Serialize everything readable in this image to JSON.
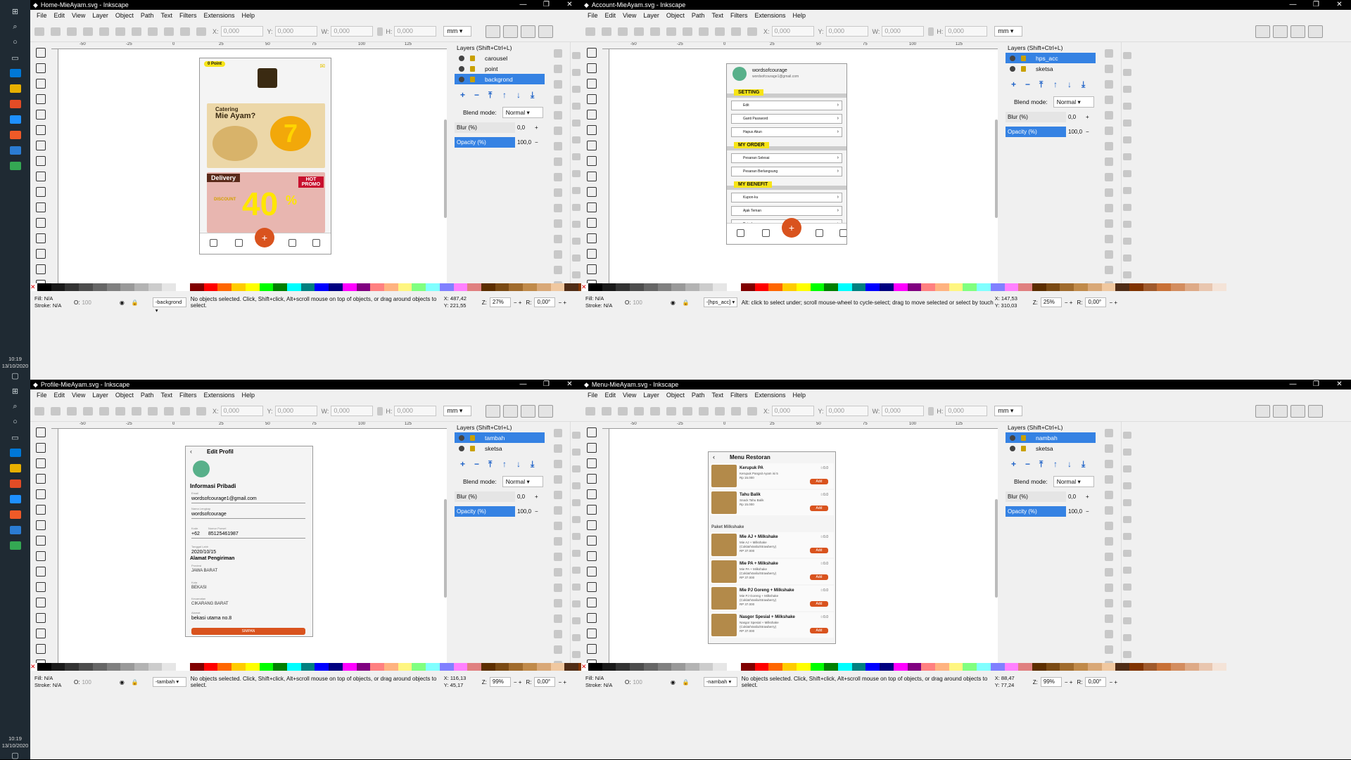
{
  "clock": {
    "top_time": "10:19",
    "top_date": "13/10/2020",
    "bottom_time": "10:19",
    "bottom_date": "13/10/2020"
  },
  "windows": [
    {
      "title": "Home-MieAyam.svg - Inkscape",
      "layers": [
        "carousel",
        "point",
        "backgrond"
      ],
      "selected_layer": 2,
      "status_layer": "-backgrond",
      "status_msg": "No objects selected. Click, Shift+click, Alt+scroll mouse on top of objects, or drag around objects to select.",
      "x": "487,42",
      "y": "221,55",
      "zoom": "27%",
      "rot": "0,00°"
    },
    {
      "title": "Account-MieAyam.svg - Inkscape",
      "layers": [
        "hps_acc",
        "sketsa"
      ],
      "selected_layer": 0,
      "status_layer": "-[hps_acc]",
      "status_msg": "Alt: click to select under; scroll mouse-wheel to cycle-select; drag to move selected or select by touch",
      "x": "147,53",
      "y": "310,03",
      "zoom": "25%",
      "rot": "0,00°"
    },
    {
      "title": "Profile-MieAyam.svg - Inkscape",
      "layers": [
        "tambah",
        "sketsa"
      ],
      "selected_layer": 0,
      "status_layer": "-tambah",
      "status_msg": "No objects selected. Click, Shift+click, Alt+scroll mouse on top of objects, or drag around objects to select.",
      "x": "116,13",
      "y": "45,17",
      "zoom": "99%",
      "rot": "0,00°"
    },
    {
      "title": "Menu-MieAyam.svg - Inkscape",
      "layers": [
        "nambah",
        "sketsa"
      ],
      "selected_layer": 0,
      "status_layer": "-nambah",
      "status_msg": "No objects selected. Click, Shift+click, Alt+scroll mouse on top of objects, or drag around objects to select.",
      "x": "88,47",
      "y": "77,24",
      "zoom": "99%",
      "rot": "0,00°"
    }
  ],
  "ui": {
    "menus": [
      "File",
      "Edit",
      "View",
      "Layer",
      "Object",
      "Path",
      "Text",
      "Filters",
      "Extensions",
      "Help"
    ],
    "x_label": "X:",
    "y_label": "Y:",
    "w_label": "W:",
    "h_label": "H:",
    "coord_value": "0,000",
    "unit": "mm",
    "layers_title": "Layers (Shift+Ctrl+L)",
    "blend_label": "Blend mode:",
    "blend_value": "Normal",
    "blur_label": "Blur (%)",
    "blur_value": "0,0",
    "opacity_label": "Opacity (%)",
    "opacity_value": "100,0",
    "fill_label": "Fill:",
    "fill_value": "N/A",
    "stroke_label": "Stroke:",
    "stroke_value": "N/A",
    "o_label": "O:",
    "o_value": "100",
    "x_s": "X:",
    "y_s": "Y:",
    "z_s": "Z:",
    "r_s": "R:"
  },
  "home": {
    "point": "0 Point",
    "catering": "Catering",
    "mie": "Mie Ayam?",
    "delivery": "Delivery",
    "hot": "HOT PROMO",
    "discount": "DISCOUNT",
    "forty": "40",
    "percent": "%"
  },
  "account": {
    "name": "wordsofcourage",
    "email": "wordsofcourage1@gmail.com",
    "sec1": "SETTING",
    "s1": [
      "Edit",
      "Ganti Password",
      "Hapus Akun"
    ],
    "sec2": "MY ORDER",
    "s2": [
      "Pesanan Selesai",
      "Pesanan Berlangsung"
    ],
    "sec3": "MY BENEFIT",
    "s3": [
      "Kupon-ku",
      "Ajak Teman",
      "Poin-ku"
    ]
  },
  "profile": {
    "title": "Edit Profil",
    "info": "Informasi Pribadi",
    "email_l": "Email",
    "email": "wordsofcourage1@gmail.com",
    "nama_l": "Nama Lengkap",
    "nama": "wordsofcourage",
    "kode_l": "Kode",
    "phone_l": "Nomor Ponsel",
    "kode": "+62",
    "phone": "85125461987",
    "tgl_l": "Tanggal Lahir",
    "tgl": "2020/10/15",
    "alamat": "Alamat Pengiriman",
    "prov_l": "Provinsi",
    "prov": "JAWA BARAT",
    "kota_l": "Kota",
    "kota": "BEKASI",
    "kec_l": "Kecamatan",
    "kec": "CIKARANG BARAT",
    "almt_l": "Alamat",
    "almt": "bekasi utama no.8",
    "btn": "SIMPAN"
  },
  "menu": {
    "title": "Menu Restoran",
    "paket": "Paket Milkshake",
    "add": "Add",
    "star": "☆0.0",
    "items": [
      {
        "name": "Kerupuk PA",
        "desc": "Kerupuk Pangsit Ayam isi 5",
        "price": "Rp 15.000"
      },
      {
        "name": "Tahu Balik",
        "desc": "Snack Tahu Balik",
        "price": "Rp 15.000"
      }
    ],
    "paket_items": [
      {
        "name": "Mie AJ + Milkshake",
        "desc": "Mie AJ + Milkshake (Coklat/Vanila/Strawberry)",
        "price": "RP 37.000"
      },
      {
        "name": "Mie PA + Milkshake",
        "desc": "Mie PA + Milkshake (Coklat/Vanila/Strawberry)",
        "price": "RP 37.000"
      },
      {
        "name": "Mie PJ Goreng + Milkshake",
        "desc": "Mie PJ Goreng + Milkshake (Coklat/Vanila/Strawberry)",
        "price": "RP 37.000"
      },
      {
        "name": "Nasgor Spesial + Milkshake",
        "desc": "Nasgor Spesial + Milkshake (Coklat/Vanila/Strawberry)",
        "price": "RP 37.000"
      }
    ]
  },
  "ruler_top": [
    "-50",
    "-25",
    "0",
    "25",
    "50",
    "75",
    "100",
    "125"
  ],
  "colors": {
    "accent": "#3582e3",
    "orange": "#d9531e",
    "yellow": "#f7e417",
    "taskbar": "#1f2a33"
  }
}
